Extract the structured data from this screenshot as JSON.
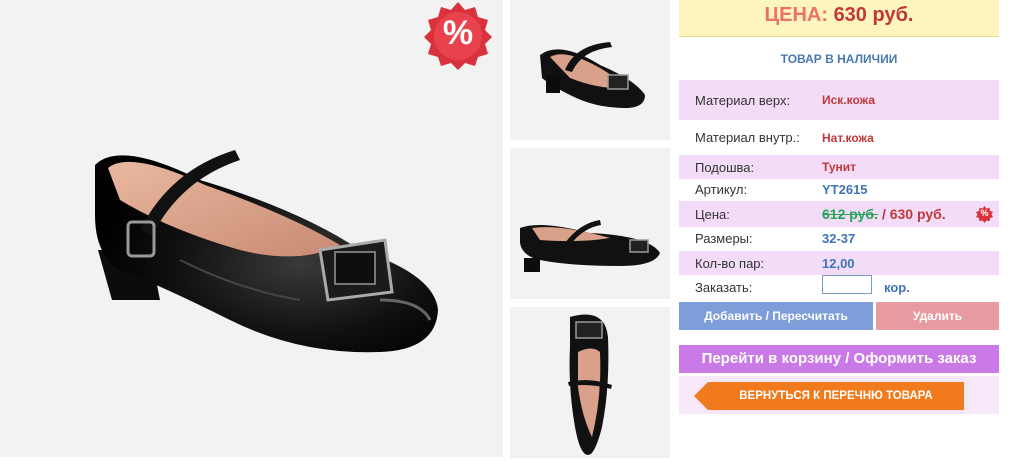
{
  "product": {
    "main_image": "black patent leather girls' mary jane shoe with strap and buckle",
    "thumbnails": [
      "shoe three-quarter view",
      "shoe side view",
      "shoe top view"
    ],
    "sale_badge": "%"
  },
  "header": {
    "price_label": "ЦЕНА:",
    "price_value": "630 руб."
  },
  "stock_status": "ТОВАР В НАЛИЧИИ",
  "specs": {
    "material_top": {
      "label": "Материал верх:",
      "value": "Иск.кожа"
    },
    "material_inner": {
      "label": "Материал внутр.:",
      "value": "Нат.кожа"
    },
    "sole": {
      "label": "Подошва:",
      "value": "Тунит"
    },
    "article": {
      "label": "Артикул:",
      "value": "YT2615"
    },
    "price": {
      "label": "Цена:",
      "old": "612 руб.",
      "new": "/ 630 руб.",
      "badge": "%"
    },
    "sizes": {
      "label": "Размеры:",
      "value": "32-37"
    },
    "pairs": {
      "label": "Кол-во пар:",
      "value": "12,00"
    },
    "order": {
      "label": "Заказать:",
      "quantity": "",
      "unit": "кор."
    }
  },
  "buttons": {
    "add": "Добавить / Пересчитать",
    "delete": "Удалить",
    "cart": "Перейти в корзину / Оформить заказ",
    "back": "ВЕРНУТЬСЯ К ПЕРЕЧНЮ ТОВАРА"
  },
  "colors": {
    "price_header_bg": "#fdf5bd",
    "row_shade": "#f2dcf7",
    "accent_red": "#c0393a",
    "accent_blue": "#3f74b9",
    "add_button": "#7d9ed8",
    "delete_button": "#e79a9f",
    "cart_button": "#c97ae7",
    "back_button": "#f17a1c"
  }
}
